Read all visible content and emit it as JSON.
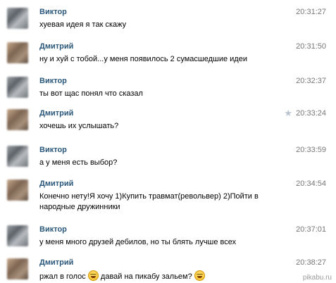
{
  "messages": [
    {
      "author": "Виктор",
      "time": "20:31:27",
      "text": "хуевая идея я так скажу"
    },
    {
      "author": "Дмитрий",
      "time": "20:31:50",
      "text": "ну и хуй с тобой...у меня появилось 2 сумасшедшие идеи"
    },
    {
      "author": "Виктор",
      "time": "20:32:37",
      "text": "ты вот щас понял что сказал"
    },
    {
      "author": "Дмитрий",
      "time": "20:33:24",
      "text": "хочешь их услышать?"
    },
    {
      "author": "Виктор",
      "time": "20:33:59",
      "text": "а у меня есть выбор?"
    },
    {
      "author": "Дмитрий",
      "time": "20:34:54",
      "text_line1": "Конечно нету!Я хочу 1)Купить травмат(револьвер) 2)Пойти в",
      "text_line2": "народные дружинники"
    },
    {
      "author": "Виктор",
      "time": "20:37:01",
      "text": "у меня много друзей дебилов, но ты блять лучше всех"
    },
    {
      "author": "Дмитрий",
      "time": "20:38:27",
      "text_a": "ржал в голос",
      "text_b": "давай на пикабу зальем?"
    }
  ],
  "icons": {
    "star": "star-icon",
    "emoji": "laughing-emoji-icon"
  },
  "watermark": "pikabu.ru"
}
